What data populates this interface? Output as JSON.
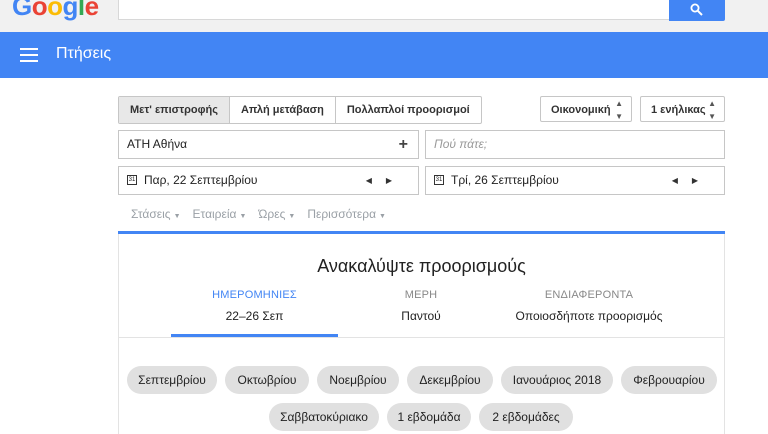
{
  "logo": {
    "text": "Google"
  },
  "header": {
    "title": "Πτήσεις"
  },
  "trip_types": [
    "Μετ' επιστροφής",
    "Απλή μετάβαση",
    "Πολλαπλοί προορισμοί"
  ],
  "cabin_class": "Οικονομική",
  "passengers": "1 ενήλικας",
  "origin": "ΑΤΗ Αθήνα",
  "destination_placeholder": "Πού πάτε;",
  "depart_date": "Παρ, 22 Σεπτεμβρίου",
  "return_date": "Τρί, 26 Σεπτεμβρίου",
  "filters": [
    "Στάσεις",
    "Εταιρεία",
    "Ώρες",
    "Περισσότερα"
  ],
  "discover": {
    "title": "Ανακαλύψτε προορισμούς",
    "columns": [
      {
        "heading": "ΗΜΕΡΟΜΗΝΙΕΣ",
        "value": "22–26 Σεπ"
      },
      {
        "heading": "ΜΕΡΗ",
        "value": "Παντού"
      },
      {
        "heading": "ΕΝΔΙΑΦΕΡΟΝΤΑ",
        "value": "Οποιοσδήποτε προορισμός"
      }
    ],
    "month_chips": [
      "Σεπτεμβρίου",
      "Οκτωβρίου",
      "Νοεμβρίου",
      "Δεκεμβρίου",
      "Ιανουάριος 2018",
      "Φεβρουαρίου"
    ],
    "duration_chips": [
      "Σαββατοκύριακο",
      "1 εβδομάδα",
      "2 εβδομάδες"
    ]
  },
  "colors": {
    "brand_blue": "#4285f4"
  }
}
